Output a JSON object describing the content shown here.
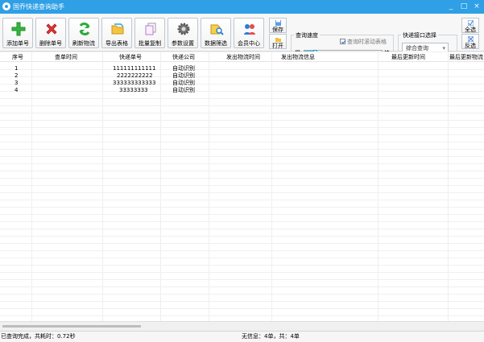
{
  "window": {
    "title": "国乔快递查询助手",
    "minimize": "_",
    "maximize": "□",
    "close": "×"
  },
  "toolbar": {
    "buttons": [
      {
        "label": "添加单号",
        "icon": "green-plus-icon"
      },
      {
        "label": "删除单号",
        "icon": "red-x-icon"
      },
      {
        "label": "刷新物流",
        "icon": "refresh-icon"
      },
      {
        "label": "导出表格",
        "icon": "folder-icon"
      },
      {
        "label": "批量复制",
        "icon": "copy-icon"
      },
      {
        "label": "参数设置",
        "icon": "gear-icon"
      },
      {
        "label": "数据筛选",
        "icon": "filter-search-icon"
      },
      {
        "label": "会员中心",
        "icon": "members-icon"
      }
    ],
    "save_label": "保存",
    "open_label": "打开",
    "select_all_label": "全选",
    "invert_label": "反选"
  },
  "speed": {
    "title": "查询速度",
    "scroll_table_label": "查询时滚动表格",
    "slow": "慢",
    "fast": "快",
    "level": 0.15,
    "scroll_checked": true
  },
  "api": {
    "title": "快递接口选择",
    "selected": "综合查询"
  },
  "table": {
    "columns": [
      "序号",
      "查单时间",
      "快递单号",
      "快递公司",
      "发出物流时间",
      "发出物流信息",
      "最后更新时间",
      "最后更新物流"
    ],
    "rows": [
      [
        "1",
        "",
        "111111111111",
        "自动识别",
        "",
        "",
        "",
        ""
      ],
      [
        "2",
        "",
        "2222222222",
        "自动识别",
        "",
        "",
        "",
        ""
      ],
      [
        "3",
        "",
        "333333333333",
        "自动识别",
        "",
        "",
        "",
        ""
      ],
      [
        "4",
        "",
        "33333333",
        "自动识别",
        "",
        "",
        "",
        ""
      ]
    ]
  },
  "status": {
    "left": "已查询完成，共耗时：0.72秒",
    "center": "无信息：4单，共：4单"
  },
  "colors": {
    "titlebar": "#2f9fe6",
    "accent": "#1e9dc4"
  }
}
